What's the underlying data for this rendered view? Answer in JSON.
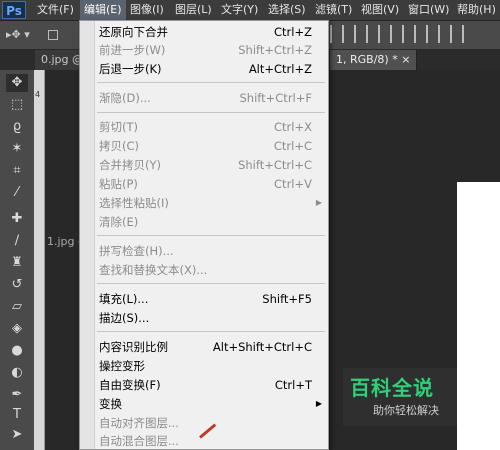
{
  "app": {
    "logo": "Ps"
  },
  "menubar": {
    "items": [
      {
        "label": "文件(F)"
      },
      {
        "label": "编辑(E)"
      },
      {
        "label": "图像(I)"
      },
      {
        "label": "图层(L)"
      },
      {
        "label": "文字(Y)"
      },
      {
        "label": "选择(S)"
      },
      {
        "label": "滤镜(T)"
      },
      {
        "label": "视图(V)"
      },
      {
        "label": "窗口(W)"
      },
      {
        "label": "帮助(H)"
      }
    ]
  },
  "tabs": {
    "left": "0.jpg @",
    "right": "1, RGB/8) * ×",
    "left2": "1.jpg @"
  },
  "ruler": {
    "mark": "4"
  },
  "edit_menu": {
    "items": [
      {
        "label": "还原向下合并",
        "shortcut": "Ctrl+Z"
      },
      {
        "label": "前进一步(W)",
        "shortcut": "Shift+Ctrl+Z"
      },
      {
        "label": "后退一步(K)",
        "shortcut": "Alt+Ctrl+Z"
      },
      {
        "label": "渐隐(D)...",
        "shortcut": "Shift+Ctrl+F"
      },
      {
        "label": "剪切(T)",
        "shortcut": "Ctrl+X"
      },
      {
        "label": "拷贝(C)",
        "shortcut": "Ctrl+C"
      },
      {
        "label": "合并拷贝(Y)",
        "shortcut": "Shift+Ctrl+C"
      },
      {
        "label": "粘贴(P)",
        "shortcut": "Ctrl+V"
      },
      {
        "label": "选择性粘贴(I)",
        "shortcut": ""
      },
      {
        "label": "清除(E)",
        "shortcut": ""
      },
      {
        "label": "拼写检查(H)...",
        "shortcut": ""
      },
      {
        "label": "查找和替换文本(X)...",
        "shortcut": ""
      },
      {
        "label": "填充(L)...",
        "shortcut": "Shift+F5"
      },
      {
        "label": "描边(S)...",
        "shortcut": ""
      },
      {
        "label": "内容识别比例",
        "shortcut": "Alt+Shift+Ctrl+C"
      },
      {
        "label": "操控变形",
        "shortcut": ""
      },
      {
        "label": "自由变换(F)",
        "shortcut": "Ctrl+T"
      },
      {
        "label": "变换",
        "shortcut": ""
      },
      {
        "label": "自动对齐图层...",
        "shortcut": ""
      },
      {
        "label": "自动混合图层...",
        "shortcut": ""
      }
    ]
  },
  "watermark": {
    "title": "百科全说",
    "subtitle": "助你轻松解决"
  }
}
